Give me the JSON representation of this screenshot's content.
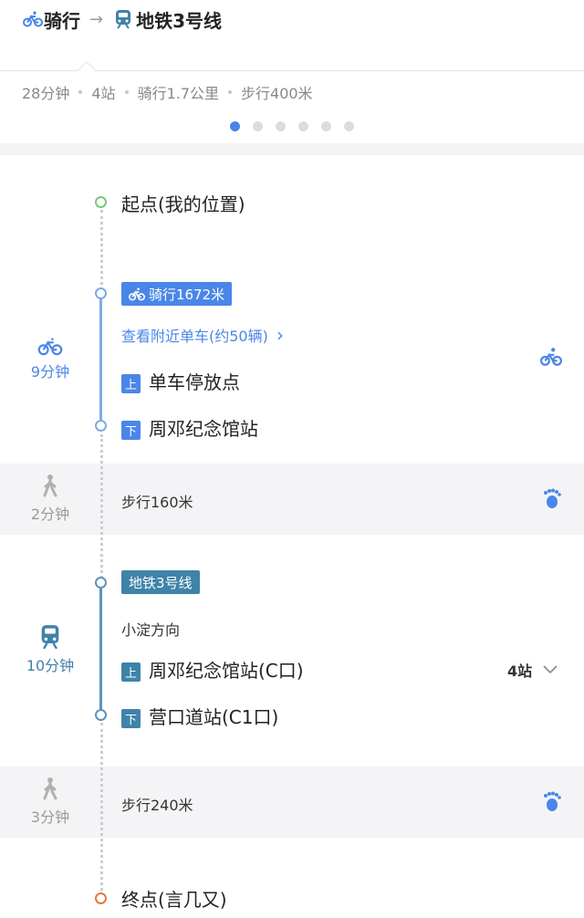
{
  "header": {
    "origin_mode": "骑行",
    "arrow": "→",
    "destination_line": "地铁3号线"
  },
  "summary": [
    "28分钟",
    "4站",
    "骑行1.7公里",
    "步行400米"
  ],
  "pager": {
    "count": 6,
    "active": 0
  },
  "start": {
    "label": "起点(我的位置)"
  },
  "bike_segment": {
    "duration": "9分钟",
    "badge": "骑行1672米",
    "nearby_link": "查看附近单车(约50辆)",
    "chevron": "›",
    "board_tag": "上",
    "board": "单车停放点",
    "alight_tag": "下",
    "alight": "周邓纪念馆站"
  },
  "walk1": {
    "duration": "2分钟",
    "text": "步行160米"
  },
  "metro_segment": {
    "duration": "10分钟",
    "badge": "地铁3号线",
    "direction": "小淀方向",
    "board_tag": "上",
    "board": "周邓纪念馆站(C口)",
    "stops": "4站",
    "alight_tag": "下",
    "alight": "营口道站(C1口)"
  },
  "walk2": {
    "duration": "3分钟",
    "text": "步行240米"
  },
  "end": {
    "label": "终点(言几又)"
  },
  "colors": {
    "accent_blue": "#4a86e8",
    "metro_teal": "#3f83a8",
    "start_green": "#7cc67a",
    "end_orange": "#e07a3e"
  },
  "icons": [
    "bike-icon",
    "metro-icon",
    "walker-icon",
    "footprint-icon",
    "chevron-down-icon"
  ]
}
